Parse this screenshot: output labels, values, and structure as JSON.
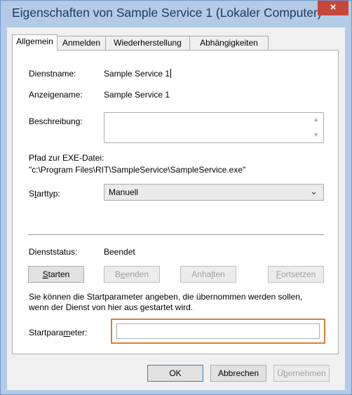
{
  "window": {
    "title": "Eigenschaften von Sample Service 1 (Lokaler Computer)",
    "close_glyph": "×"
  },
  "tabs": [
    {
      "label": "Allgemein",
      "active": true
    },
    {
      "label": "Anmelden",
      "active": false
    },
    {
      "label": "Wiederherstellung",
      "active": false
    },
    {
      "label": "Abhängigkeiten",
      "active": false
    }
  ],
  "general": {
    "service_name_label": "Dienstname:",
    "service_name_value": "Sample Service 1",
    "display_name_label": "Anzeigename:",
    "display_name_value": "Sample Service 1",
    "description_label": "Beschreibung:",
    "description_value": "",
    "exe_path_label": "Pfad zur EXE-Datei:",
    "exe_path_value": "\"c:\\Program Files\\RIT\\SampleService\\SampleService.exe\"",
    "startup_type_label_pre": "S",
    "startup_type_label_u": "t",
    "startup_type_label_post": "arttyp:",
    "startup_type_value": "Manuell",
    "status_label": "Dienststatus:",
    "status_value": "Beendet",
    "buttons": {
      "start": {
        "pre": "",
        "u": "S",
        "post": "tarten",
        "enabled": true
      },
      "stop": {
        "pre": "B",
        "u": "e",
        "post": "enden",
        "enabled": false
      },
      "pause": {
        "pre": "Anha",
        "u": "l",
        "post": "ten",
        "enabled": false
      },
      "resume": {
        "pre": "",
        "u": "F",
        "post": "ortsetzen",
        "enabled": false
      }
    },
    "info_line1": "Sie können die Startparameter angeben, die übernommen werden sollen,",
    "info_line2": "wenn der Dienst von hier aus gestartet wird.",
    "start_params_label_pre": "Startpara",
    "start_params_label_u": "m",
    "start_params_label_post": "eter:",
    "start_params_value": ""
  },
  "footer": {
    "ok": "OK",
    "cancel": "Abbrechen",
    "apply_pre": "Ü",
    "apply_u": "b",
    "apply_post": "ernehmen"
  },
  "colors": {
    "frame": "#b3cbe6",
    "close": "#c7463c",
    "focus_highlight": "#d5803a"
  }
}
